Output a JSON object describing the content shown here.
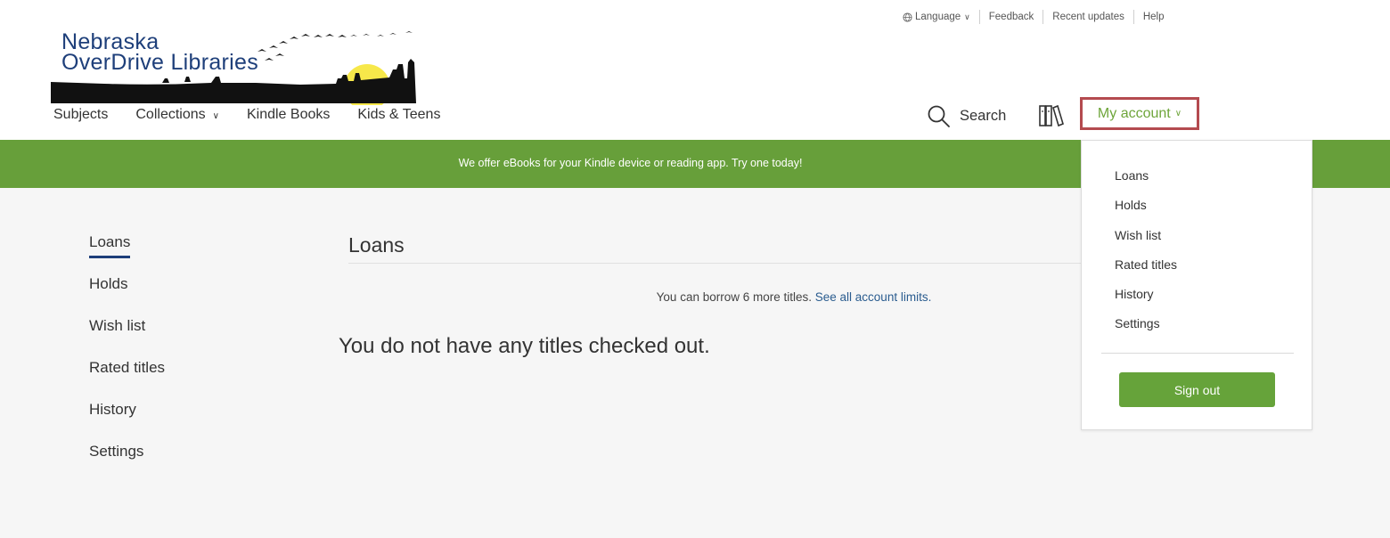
{
  "utility_links": {
    "language": "Language",
    "feedback": "Feedback",
    "recent_updates": "Recent updates",
    "help": "Help"
  },
  "logo": {
    "line1": "Nebraska",
    "line2": "OverDrive Libraries"
  },
  "nav": {
    "subjects": "Subjects",
    "collections": "Collections",
    "kindle_books": "Kindle Books",
    "kids_teens": "Kids & Teens"
  },
  "header_actions": {
    "search": "Search",
    "my_account": "My account"
  },
  "banner": {
    "text": "We offer eBooks for your Kindle device or reading app. Try one today!"
  },
  "sidebar": {
    "items": [
      {
        "label": "Loans"
      },
      {
        "label": "Holds"
      },
      {
        "label": "Wish list"
      },
      {
        "label": "Rated titles"
      },
      {
        "label": "History"
      },
      {
        "label": "Settings"
      }
    ]
  },
  "main": {
    "title": "Loans",
    "borrow_text": "You can borrow 6 more titles.",
    "limits_link": "See all account limits.",
    "empty_message": "You do not have any titles checked out."
  },
  "account_menu": {
    "items": [
      {
        "label": "Loans"
      },
      {
        "label": "Holds"
      },
      {
        "label": "Wish list"
      },
      {
        "label": "Rated titles"
      },
      {
        "label": "History"
      },
      {
        "label": "Settings"
      }
    ],
    "sign_out": "Sign out"
  },
  "colors": {
    "brand_green": "#679f3a",
    "highlight_border": "#b44a4f",
    "logo_blue": "#1e3f7a"
  }
}
